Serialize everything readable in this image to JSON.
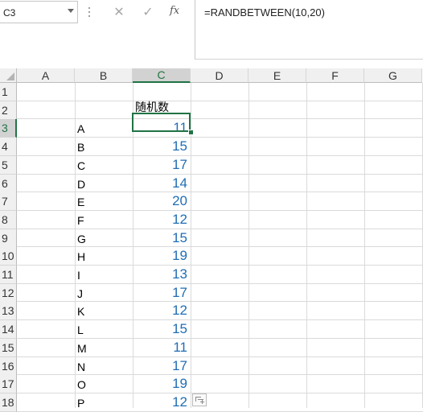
{
  "name_box": {
    "value": "C3"
  },
  "formula_bar": {
    "cancel_symbol": "✕",
    "enter_symbol": "✓",
    "fx_label": "fx",
    "formula": "=RANDBETWEEN(10,20)"
  },
  "columns": [
    "A",
    "B",
    "C",
    "D",
    "E",
    "F",
    "G"
  ],
  "selected_column": "C",
  "rows": [
    "1",
    "2",
    "3",
    "4",
    "5",
    "6",
    "7",
    "8",
    "9",
    "10",
    "11",
    "12",
    "13",
    "14",
    "15",
    "16",
    "17",
    "18"
  ],
  "selected_row": "3",
  "sheet": {
    "header_cell": "随机数",
    "labels": [
      "A",
      "B",
      "C",
      "D",
      "E",
      "F",
      "G",
      "H",
      "I",
      "J",
      "K",
      "L",
      "M",
      "N",
      "O",
      "P"
    ],
    "values": [
      "11",
      "15",
      "17",
      "14",
      "20",
      "12",
      "15",
      "19",
      "13",
      "17",
      "12",
      "15",
      "11",
      "17",
      "19",
      "12"
    ]
  },
  "colors": {
    "accent": "#217346",
    "value_text": "#1f6db5"
  }
}
